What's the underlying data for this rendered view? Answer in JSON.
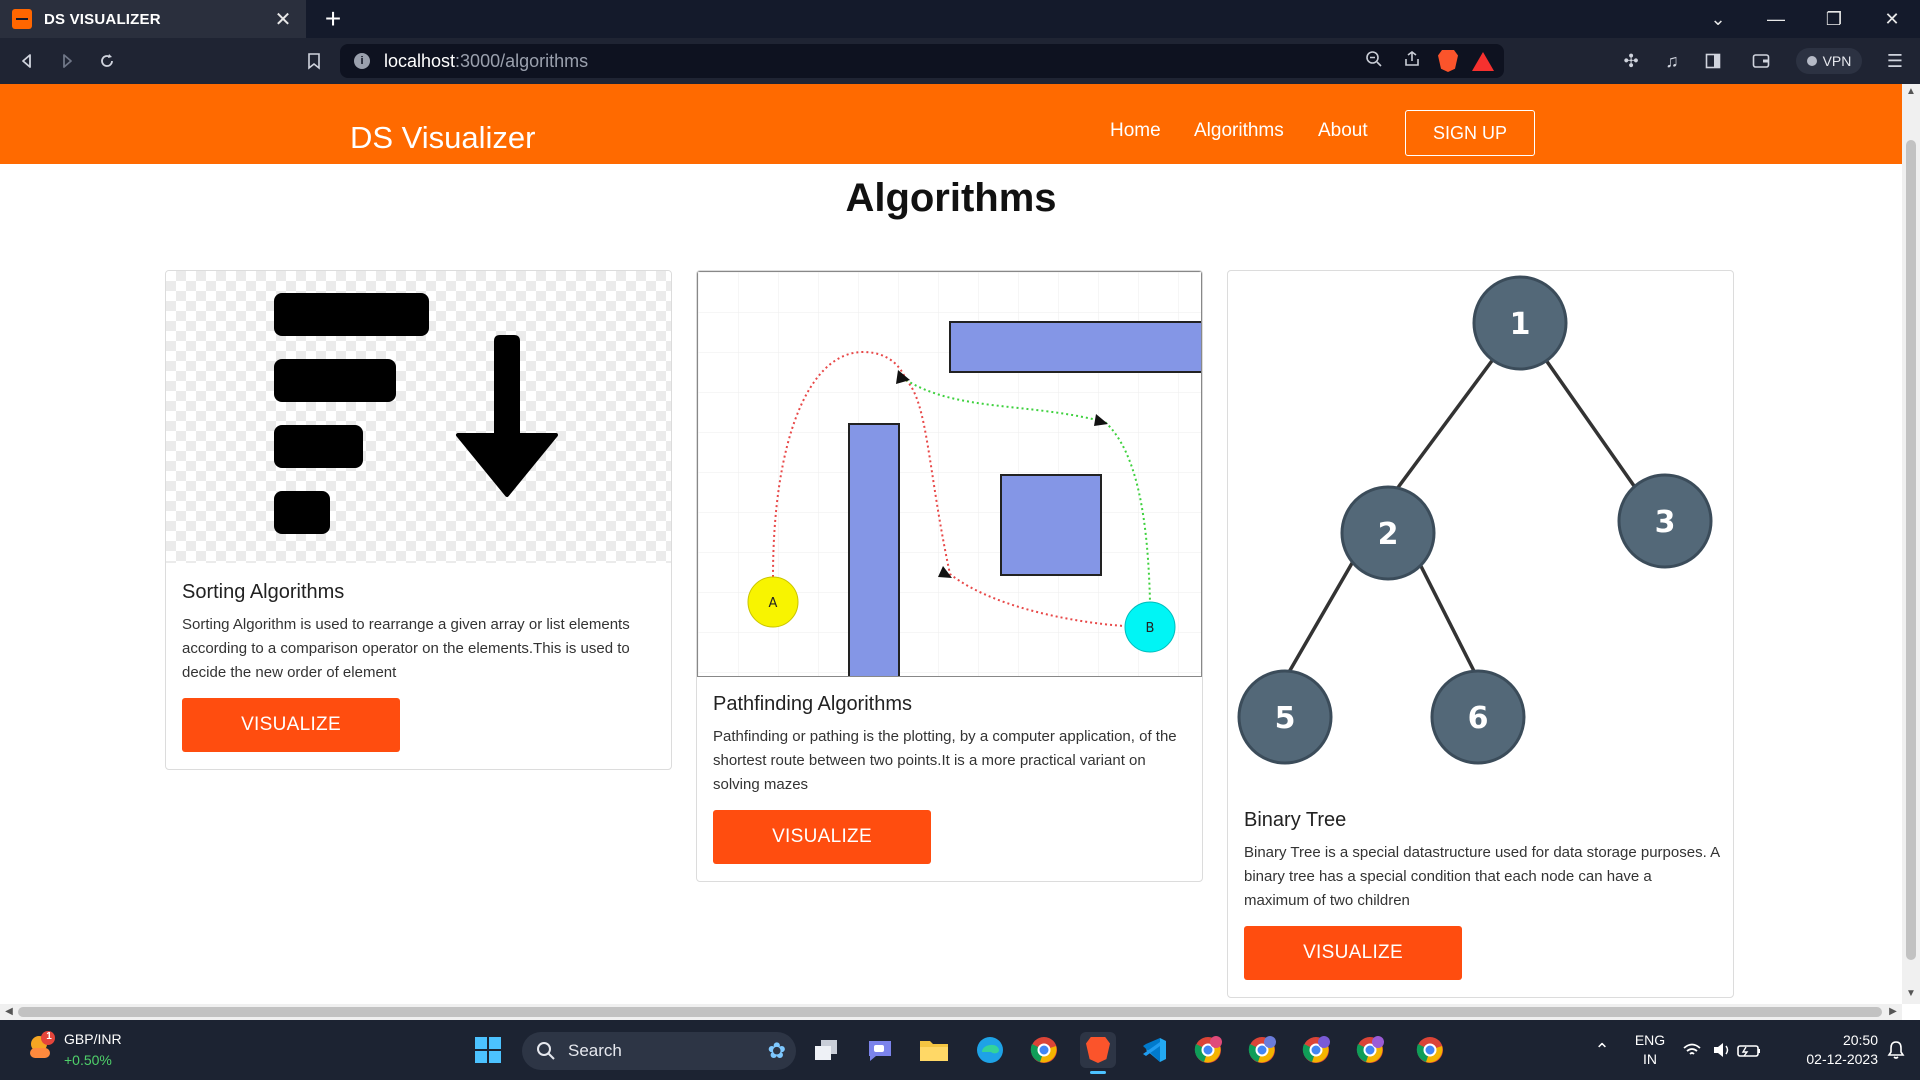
{
  "browser": {
    "tab_title": "DS VISUALIZER",
    "url_host": "localhost",
    "url_path": ":3000/algorithms",
    "vpn_label": "VPN"
  },
  "navbar": {
    "brand": "DS Visualizer",
    "links": [
      "Home",
      "Algorithms",
      "About"
    ],
    "signup_label": "SIGN UP",
    "color": "#ff6a00"
  },
  "page": {
    "title": "Algorithms",
    "cards": [
      {
        "title": "Sorting Algorithms",
        "text": "Sorting Algorithm is used to rearrange a given array or list elements according to a comparison operator on the elements.This is used to decide the new order of element",
        "button": "VISUALIZE"
      },
      {
        "title": "Pathfinding Algorithms",
        "text": "Pathfinding or pathing is the plotting, by a computer application, of the shortest route between two points.It is a more practical variant on solving mazes",
        "button": "VISUALIZE",
        "markers": [
          "A",
          "B"
        ]
      },
      {
        "title": "Binary Tree",
        "text": "Binary Tree is a special datastructure used for data storage purposes. A binary tree has a special condition that each node can have a maximum of two children",
        "button": "VISUALIZE",
        "nodes": [
          "1",
          "2",
          "3",
          "5",
          "6"
        ]
      }
    ],
    "button_color": "#ff4d0f"
  },
  "taskbar": {
    "ticker_name": "GBP/INR",
    "ticker_change": "+0.50%",
    "ticker_badge": "1",
    "search_label": "Search",
    "lang_top": "ENG",
    "lang_bottom": "IN",
    "time": "20:50",
    "date": "02-12-2023"
  }
}
